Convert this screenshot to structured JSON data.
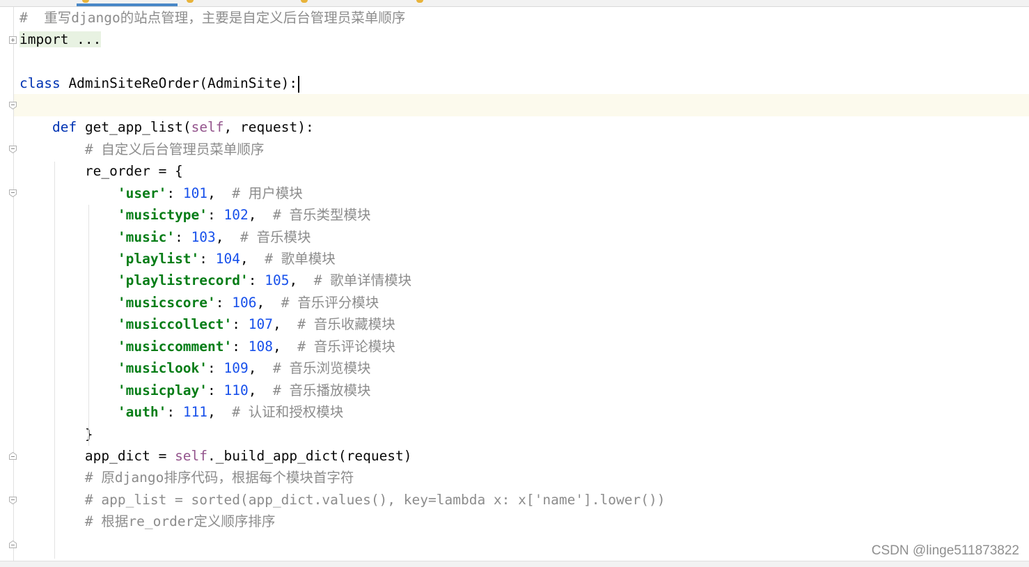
{
  "lines": [
    {
      "id": "l1",
      "parts": [
        {
          "t": "#  ",
          "c": "cm"
        },
        {
          "t": "重写",
          "c": "cm cjk"
        },
        {
          "t": "django",
          "c": "cm"
        },
        {
          "t": "的站点管理，主要是自定义后台管理员菜单顺序",
          "c": "cm cjk"
        }
      ]
    },
    {
      "id": "l2",
      "parts": [
        {
          "t": "import ...",
          "c": "fold-import"
        }
      ]
    },
    {
      "id": "l3",
      "parts": []
    },
    {
      "id": "l4",
      "parts": [
        {
          "t": "class",
          "c": "kw"
        },
        {
          "t": " AdminSiteReOrder(AdminSite):",
          "c": ""
        }
      ]
    },
    {
      "id": "l5",
      "parts": []
    },
    {
      "id": "l6",
      "parts": [
        {
          "t": "    ",
          "c": ""
        },
        {
          "t": "def",
          "c": "kw"
        },
        {
          "t": " get_app_list(",
          "c": ""
        },
        {
          "t": "self",
          "c": "self"
        },
        {
          "t": ", request):",
          "c": ""
        }
      ]
    },
    {
      "id": "l7",
      "parts": [
        {
          "t": "        ",
          "c": ""
        },
        {
          "t": "# ",
          "c": "cm"
        },
        {
          "t": "自定义后台管理员菜单顺序",
          "c": "cm cjk"
        }
      ]
    },
    {
      "id": "l8",
      "parts": [
        {
          "t": "        re_order = {",
          "c": ""
        }
      ]
    },
    {
      "id": "l9",
      "parts": [
        {
          "t": "            ",
          "c": ""
        },
        {
          "t": "'user'",
          "c": "str"
        },
        {
          "t": ": ",
          "c": ""
        },
        {
          "t": "101",
          "c": "num"
        },
        {
          "t": ",  ",
          "c": ""
        },
        {
          "t": "# ",
          "c": "cm"
        },
        {
          "t": "用户模块",
          "c": "cm cjk"
        }
      ]
    },
    {
      "id": "l10",
      "parts": [
        {
          "t": "            ",
          "c": ""
        },
        {
          "t": "'musictype'",
          "c": "str"
        },
        {
          "t": ": ",
          "c": ""
        },
        {
          "t": "102",
          "c": "num"
        },
        {
          "t": ",  ",
          "c": ""
        },
        {
          "t": "# ",
          "c": "cm"
        },
        {
          "t": "音乐类型模块",
          "c": "cm cjk"
        }
      ]
    },
    {
      "id": "l11",
      "parts": [
        {
          "t": "            ",
          "c": ""
        },
        {
          "t": "'music'",
          "c": "str"
        },
        {
          "t": ": ",
          "c": ""
        },
        {
          "t": "103",
          "c": "num"
        },
        {
          "t": ",  ",
          "c": ""
        },
        {
          "t": "# ",
          "c": "cm"
        },
        {
          "t": "音乐模块",
          "c": "cm cjk"
        }
      ]
    },
    {
      "id": "l12",
      "parts": [
        {
          "t": "            ",
          "c": ""
        },
        {
          "t": "'playlist'",
          "c": "str"
        },
        {
          "t": ": ",
          "c": ""
        },
        {
          "t": "104",
          "c": "num"
        },
        {
          "t": ",  ",
          "c": ""
        },
        {
          "t": "# ",
          "c": "cm"
        },
        {
          "t": "歌单模块",
          "c": "cm cjk"
        }
      ]
    },
    {
      "id": "l13",
      "parts": [
        {
          "t": "            ",
          "c": ""
        },
        {
          "t": "'playlistrecord'",
          "c": "str"
        },
        {
          "t": ": ",
          "c": ""
        },
        {
          "t": "105",
          "c": "num"
        },
        {
          "t": ",  ",
          "c": ""
        },
        {
          "t": "# ",
          "c": "cm"
        },
        {
          "t": "歌单详情模块",
          "c": "cm cjk"
        }
      ]
    },
    {
      "id": "l14",
      "parts": [
        {
          "t": "            ",
          "c": ""
        },
        {
          "t": "'musicscore'",
          "c": "str"
        },
        {
          "t": ": ",
          "c": ""
        },
        {
          "t": "106",
          "c": "num"
        },
        {
          "t": ",  ",
          "c": ""
        },
        {
          "t": "# ",
          "c": "cm"
        },
        {
          "t": "音乐评分模块",
          "c": "cm cjk"
        }
      ]
    },
    {
      "id": "l15",
      "parts": [
        {
          "t": "            ",
          "c": ""
        },
        {
          "t": "'musiccollect'",
          "c": "str"
        },
        {
          "t": ": ",
          "c": ""
        },
        {
          "t": "107",
          "c": "num"
        },
        {
          "t": ",  ",
          "c": ""
        },
        {
          "t": "# ",
          "c": "cm"
        },
        {
          "t": "音乐收藏模块",
          "c": "cm cjk"
        }
      ]
    },
    {
      "id": "l16",
      "parts": [
        {
          "t": "            ",
          "c": ""
        },
        {
          "t": "'musiccomment'",
          "c": "str"
        },
        {
          "t": ": ",
          "c": ""
        },
        {
          "t": "108",
          "c": "num"
        },
        {
          "t": ",  ",
          "c": ""
        },
        {
          "t": "# ",
          "c": "cm"
        },
        {
          "t": "音乐评论模块",
          "c": "cm cjk"
        }
      ]
    },
    {
      "id": "l17",
      "parts": [
        {
          "t": "            ",
          "c": ""
        },
        {
          "t": "'musiclook'",
          "c": "str"
        },
        {
          "t": ": ",
          "c": ""
        },
        {
          "t": "109",
          "c": "num"
        },
        {
          "t": ",  ",
          "c": ""
        },
        {
          "t": "# ",
          "c": "cm"
        },
        {
          "t": "音乐浏览模块",
          "c": "cm cjk"
        }
      ]
    },
    {
      "id": "l18",
      "parts": [
        {
          "t": "            ",
          "c": ""
        },
        {
          "t": "'musicplay'",
          "c": "str"
        },
        {
          "t": ": ",
          "c": ""
        },
        {
          "t": "110",
          "c": "num"
        },
        {
          "t": ",  ",
          "c": ""
        },
        {
          "t": "# ",
          "c": "cm"
        },
        {
          "t": "音乐播放模块",
          "c": "cm cjk"
        }
      ]
    },
    {
      "id": "l19",
      "parts": [
        {
          "t": "            ",
          "c": ""
        },
        {
          "t": "'auth'",
          "c": "str"
        },
        {
          "t": ": ",
          "c": ""
        },
        {
          "t": "111",
          "c": "num"
        },
        {
          "t": ",  ",
          "c": ""
        },
        {
          "t": "# ",
          "c": "cm"
        },
        {
          "t": "认证和授权模块",
          "c": "cm cjk"
        }
      ]
    },
    {
      "id": "l20",
      "parts": [
        {
          "t": "        }",
          "c": ""
        }
      ]
    },
    {
      "id": "l21",
      "parts": [
        {
          "t": "        app_dict = ",
          "c": ""
        },
        {
          "t": "self",
          "c": "self"
        },
        {
          "t": "._build_app_dict(request)",
          "c": ""
        }
      ]
    },
    {
      "id": "l22",
      "parts": [
        {
          "t": "        ",
          "c": ""
        },
        {
          "t": "# ",
          "c": "cm"
        },
        {
          "t": "原",
          "c": "cm cjk"
        },
        {
          "t": "django",
          "c": "cm"
        },
        {
          "t": "排序代码，根据每个模块首字符",
          "c": "cm cjk"
        }
      ]
    },
    {
      "id": "l23",
      "parts": [
        {
          "t": "        ",
          "c": ""
        },
        {
          "t": "# app_list = sorted(app_dict.values(), key=lambda x: x['name'].lower())",
          "c": "cm"
        }
      ]
    },
    {
      "id": "l24",
      "parts": [
        {
          "t": "        ",
          "c": ""
        },
        {
          "t": "# ",
          "c": "cm"
        },
        {
          "t": "根据",
          "c": "cm cjk"
        },
        {
          "t": "re_order",
          "c": "cm"
        },
        {
          "t": "定义顺序排序",
          "c": "cm cjk"
        }
      ]
    }
  ],
  "watermark": "CSDN @linge511873822",
  "colors": {
    "keyword": "#0033b3",
    "string": "#067d17",
    "number": "#1750eb",
    "comment": "#8c8c8c",
    "self": "#94558d",
    "current_line": "#fcfaed"
  }
}
